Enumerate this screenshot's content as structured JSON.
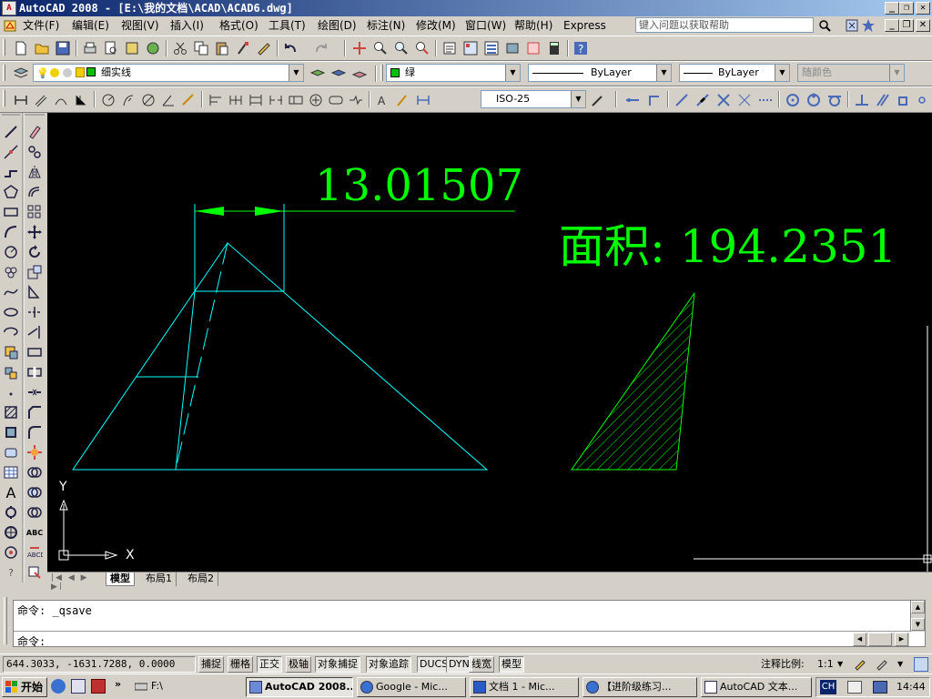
{
  "window": {
    "app_icon": "autocad-app-icon",
    "title": "AutoCAD 2008 - [E:\\我的文档\\ACAD\\ACAD6.dwg]",
    "controls": [
      "_",
      "❐",
      "✕"
    ]
  },
  "menubar": {
    "items": [
      "文件(F)",
      "编辑(E)",
      "视图(V)",
      "插入(I)",
      "格式(O)",
      "工具(T)",
      "绘图(D)",
      "标注(N)",
      "修改(M)",
      "窗口(W)",
      "帮助(H)",
      "Express"
    ],
    "help_placeholder": "键入问题以获取帮助",
    "doc_controls": [
      "_",
      "❐",
      "✕"
    ]
  },
  "toolbar_layers": {
    "layer_name": "细实线",
    "color_name": "绿",
    "linetype": "ByLayer",
    "lineweight": "ByLayer",
    "plotstyle": "随颜色"
  },
  "toolbar_dim": {
    "dimstyle": "ISO-25"
  },
  "drawing": {
    "dimension_text": "13.01507",
    "area_text": "面积: 194.2351",
    "ucs_x": "X",
    "ucs_y": "Y",
    "colors": {
      "cyan": "#00ffff",
      "green": "#00ff00",
      "background": "#000000"
    }
  },
  "layout_tabs": [
    "模型",
    "布局1",
    "布局2"
  ],
  "command": {
    "history": "命令: _qsave",
    "prompt": "命令:"
  },
  "status": {
    "coords": "644.3033, -1631.7288, 0.0000",
    "toggles": [
      "捕捉",
      "栅格",
      "正交",
      "极轴",
      "对象捕捉",
      "对象追踪",
      "DUCS",
      "DYN",
      "线宽",
      "模型"
    ],
    "annotation_scale_label": "注释比例:",
    "annotation_scale": "1:1"
  },
  "taskbar": {
    "start": "开始",
    "quick_folder": "F:\\",
    "tasks": [
      "AutoCAD 2008...",
      "Google - Mic...",
      "文档 1 - Mic...",
      "【进阶级练习...",
      "AutoCAD 文本..."
    ],
    "lang": "CH",
    "time": "14:44"
  }
}
